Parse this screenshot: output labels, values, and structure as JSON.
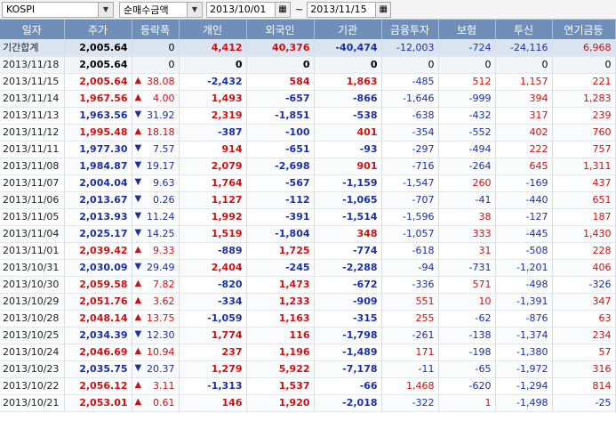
{
  "toolbar": {
    "market": "KOSPI",
    "mode": "순매수금액",
    "date_from": "2013/10/01",
    "tilde": "~",
    "date_to": "2013/11/15"
  },
  "headers": [
    "일자",
    "주가",
    "등락폭",
    "개인",
    "외국인",
    "기관",
    "금융투자",
    "보험",
    "투신",
    "연기금등"
  ],
  "rows": [
    {
      "d": "기간합계",
      "p": "2,005.64",
      "c": "0",
      "dir": "",
      "i": "4,412",
      "f": "40,376",
      "g": "-40,474",
      "fi": "-12,003",
      "ins": "-724",
      "tr": "-24,116",
      "pe": "6,968",
      "cls": "sum"
    },
    {
      "d": "2013/11/18",
      "p": "2,005.64",
      "c": "0",
      "dir": "",
      "i": "0",
      "f": "0",
      "g": "0",
      "fi": "0",
      "ins": "0",
      "tr": "0",
      "pe": "0",
      "cls": "base"
    },
    {
      "d": "2013/11/15",
      "p": "2,005.64",
      "c": "38.08",
      "dir": "up",
      "i": "-2,432",
      "f": "584",
      "g": "1,863",
      "fi": "-485",
      "ins": "512",
      "tr": "1,157",
      "pe": "221"
    },
    {
      "d": "2013/11/14",
      "p": "1,967.56",
      "c": "4.00",
      "dir": "up",
      "i": "1,493",
      "f": "-657",
      "g": "-866",
      "fi": "-1,646",
      "ins": "-999",
      "tr": "394",
      "pe": "1,283"
    },
    {
      "d": "2013/11/13",
      "p": "1,963.56",
      "c": "31.92",
      "dir": "dn",
      "i": "2,319",
      "f": "-1,851",
      "g": "-538",
      "fi": "-638",
      "ins": "-432",
      "tr": "317",
      "pe": "239"
    },
    {
      "d": "2013/11/12",
      "p": "1,995.48",
      "c": "18.18",
      "dir": "up",
      "i": "-387",
      "f": "-100",
      "g": "401",
      "fi": "-354",
      "ins": "-552",
      "tr": "402",
      "pe": "760"
    },
    {
      "d": "2013/11/11",
      "p": "1,977.30",
      "c": "7.57",
      "dir": "dn",
      "i": "914",
      "f": "-651",
      "g": "-93",
      "fi": "-297",
      "ins": "-494",
      "tr": "222",
      "pe": "757"
    },
    {
      "d": "2013/11/08",
      "p": "1,984.87",
      "c": "19.17",
      "dir": "dn",
      "i": "2,079",
      "f": "-2,698",
      "g": "901",
      "fi": "-716",
      "ins": "-264",
      "tr": "645",
      "pe": "1,311"
    },
    {
      "d": "2013/11/07",
      "p": "2,004.04",
      "c": "9.63",
      "dir": "dn",
      "i": "1,764",
      "f": "-567",
      "g": "-1,159",
      "fi": "-1,547",
      "ins": "260",
      "tr": "-169",
      "pe": "437"
    },
    {
      "d": "2013/11/06",
      "p": "2,013.67",
      "c": "0.26",
      "dir": "dn",
      "i": "1,127",
      "f": "-112",
      "g": "-1,065",
      "fi": "-707",
      "ins": "-41",
      "tr": "-440",
      "pe": "651"
    },
    {
      "d": "2013/11/05",
      "p": "2,013.93",
      "c": "11.24",
      "dir": "dn",
      "i": "1,992",
      "f": "-391",
      "g": "-1,514",
      "fi": "-1,596",
      "ins": "38",
      "tr": "-127",
      "pe": "187"
    },
    {
      "d": "2013/11/04",
      "p": "2,025.17",
      "c": "14.25",
      "dir": "dn",
      "i": "1,519",
      "f": "-1,804",
      "g": "348",
      "fi": "-1,057",
      "ins": "333",
      "tr": "-445",
      "pe": "1,430"
    },
    {
      "d": "2013/11/01",
      "p": "2,039.42",
      "c": "9.33",
      "dir": "up",
      "i": "-889",
      "f": "1,725",
      "g": "-774",
      "fi": "-618",
      "ins": "31",
      "tr": "-508",
      "pe": "228"
    },
    {
      "d": "2013/10/31",
      "p": "2,030.09",
      "c": "29.49",
      "dir": "dn",
      "i": "2,404",
      "f": "-245",
      "g": "-2,288",
      "fi": "-94",
      "ins": "-731",
      "tr": "-1,201",
      "pe": "406"
    },
    {
      "d": "2013/10/30",
      "p": "2,059.58",
      "c": "7.82",
      "dir": "up",
      "i": "-820",
      "f": "1,473",
      "g": "-672",
      "fi": "-336",
      "ins": "571",
      "tr": "-498",
      "pe": "-326"
    },
    {
      "d": "2013/10/29",
      "p": "2,051.76",
      "c": "3.62",
      "dir": "up",
      "i": "-334",
      "f": "1,233",
      "g": "-909",
      "fi": "551",
      "ins": "10",
      "tr": "-1,391",
      "pe": "347"
    },
    {
      "d": "2013/10/28",
      "p": "2,048.14",
      "c": "13.75",
      "dir": "up",
      "i": "-1,059",
      "f": "1,163",
      "g": "-315",
      "fi": "255",
      "ins": "-62",
      "tr": "-876",
      "pe": "63"
    },
    {
      "d": "2013/10/25",
      "p": "2,034.39",
      "c": "12.30",
      "dir": "dn",
      "i": "1,774",
      "f": "116",
      "g": "-1,798",
      "fi": "-261",
      "ins": "-138",
      "tr": "-1,374",
      "pe": "234"
    },
    {
      "d": "2013/10/24",
      "p": "2,046.69",
      "c": "10.94",
      "dir": "up",
      "i": "237",
      "f": "1,196",
      "g": "-1,489",
      "fi": "171",
      "ins": "-198",
      "tr": "-1,380",
      "pe": "57"
    },
    {
      "d": "2013/10/23",
      "p": "2,035.75",
      "c": "20.37",
      "dir": "dn",
      "i": "1,279",
      "f": "5,922",
      "g": "-7,178",
      "fi": "-11",
      "ins": "-65",
      "tr": "-1,972",
      "pe": "316"
    },
    {
      "d": "2013/10/22",
      "p": "2,056.12",
      "c": "3.11",
      "dir": "up",
      "i": "-1,313",
      "f": "1,537",
      "g": "-66",
      "fi": "1,468",
      "ins": "-620",
      "tr": "-1,294",
      "pe": "814"
    },
    {
      "d": "2013/10/21",
      "p": "2,053.01",
      "c": "0.61",
      "dir": "up",
      "i": "146",
      "f": "1,920",
      "g": "-2,018",
      "fi": "-322",
      "ins": "1",
      "tr": "-1,498",
      "pe": "-25"
    }
  ],
  "colors": {
    "up": "#d01010",
    "down": "#1a2fa8",
    "header": "#6f8fb8",
    "sum_row": "#dbe5f1"
  }
}
